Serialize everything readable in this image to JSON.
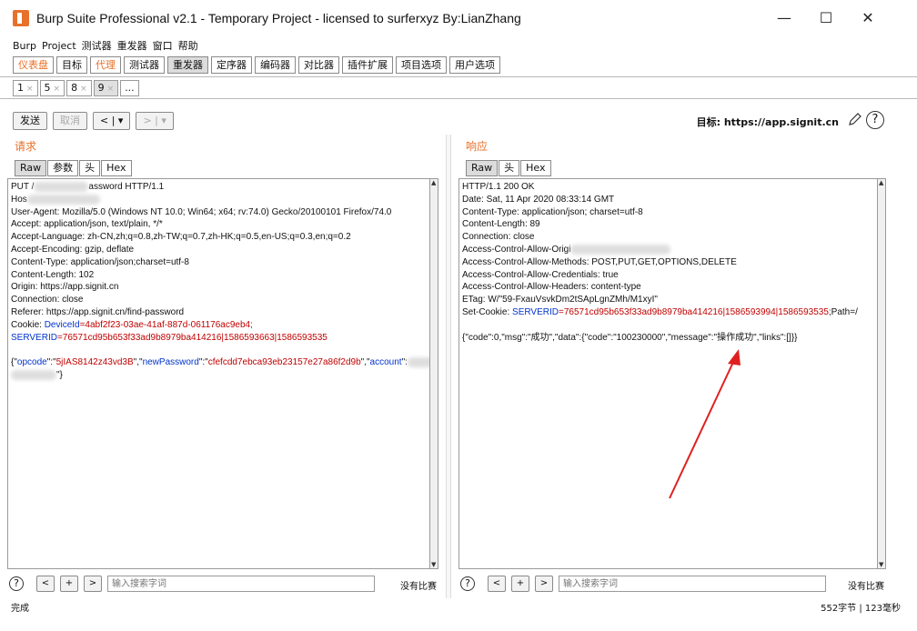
{
  "window": {
    "title": "Burp Suite Professional v2.1 - Temporary Project - licensed to surferxyz By:LianZhang",
    "minimize": "—",
    "maximize": "☐",
    "close": "✕"
  },
  "menu": [
    "Burp",
    "Project",
    "测试器",
    "重发器",
    "窗口",
    "帮助"
  ],
  "tabs": [
    "仪表盘",
    "目标",
    "代理",
    "测试器",
    "重发器",
    "定序器",
    "编码器",
    "对比器",
    "插件扩展",
    "项目选项",
    "用户选项"
  ],
  "subtabs": [
    {
      "label": "1",
      "close": "×"
    },
    {
      "label": "5",
      "close": "×"
    },
    {
      "label": "8",
      "close": "×"
    },
    {
      "label": "9",
      "close": "×"
    },
    {
      "label": "...",
      "close": ""
    }
  ],
  "toolbar": {
    "send": "发送",
    "cancel": "取消",
    "back": "< | ▾",
    "forward": "> | ▾",
    "target_label": "目标: https://app.signit.cn",
    "help": "?"
  },
  "request": {
    "title": "请求",
    "tabs": [
      "Raw",
      "参数",
      "头",
      "Hex"
    ],
    "lines": [
      "PUT /",
      "Hos",
      "User-Agent: Mozilla/5.0 (Windows NT 10.0; Win64; x64; rv:74.0) Gecko/20100101 Firefox/74.0",
      "Accept: application/json, text/plain, */*",
      "Accept-Language: zh-CN,zh;q=0.8,zh-TW;q=0.7,zh-HK;q=0.5,en-US;q=0.3,en;q=0.2",
      "Accept-Encoding: gzip, deflate",
      "Content-Type: application/json;charset=utf-8",
      "Content-Length: 102",
      "Origin: https://app.signit.cn",
      "Connection: close",
      "Referer: https://app.signit.cn/find-password"
    ],
    "line1_tail": "assword HTTP/1.1",
    "cookie_prefix": "Cookie: ",
    "cookie_key": "DeviceId",
    "cookie_val": "=4abf2f23-03ae-41af-887d-061176ac9eb4;",
    "server_key": "SERVERID",
    "server_val": "=76571cd95b653f33ad9b8979ba414216|1586593663|1586593535",
    "body_open": "{\"",
    "body_k1": "opcode",
    "body_s1": "\":\"",
    "body_v1": "5jIAS8142z43vd3B",
    "body_s2": "\",\"",
    "body_k2": "newPassword",
    "body_s3": "\":\"",
    "body_v2": "cfefcdd7ebca93eb23157e27a86f2d9b",
    "body_s4": "\",\"",
    "body_k3": "account",
    "body_s5": "\":",
    "body_close": "\"}"
  },
  "response": {
    "title": "响应",
    "tabs": [
      "Raw",
      "头",
      "Hex"
    ],
    "lines": [
      "HTTP/1.1 200 OK",
      "Date: Sat, 11 Apr 2020 08:33:14 GMT",
      "Content-Type: application/json; charset=utf-8",
      "Content-Length: 89",
      "Connection: close",
      "Access-Control-Allow-Origi",
      "Access-Control-Allow-Methods: POST,PUT,GET,OPTIONS,DELETE",
      "Access-Control-Allow-Credentials: true",
      "Access-Control-Allow-Headers: content-type",
      "ETag: W/\"59-FxauVsvkDm2tSApLgnZMh/M1xyI\""
    ],
    "setcookie_prefix": "Set-Cookie: ",
    "server_key": "SERVERID",
    "server_val": "=76571cd95b653f33ad9b8979ba414216|1586593994|1586593535",
    "setcookie_tail": ";Path=/",
    "body": "{\"code\":0,\"msg\":\"成功\",\"data\":{\"code\":\"100230000\",\"message\":\"操作成功\",\"links\":[]}}"
  },
  "search": {
    "placeholder": "输入搜索字词",
    "no_match": "没有比赛",
    "prev": "<",
    "add": "+",
    "next": ">",
    "help": "?"
  },
  "status": {
    "left": "完成",
    "right": "552字节 | 123毫秒"
  },
  "colors": {
    "accent": "#e8702a",
    "annotation_arrow": "#e02020",
    "key_blue": "#0033cc",
    "value_red": "#c00000"
  }
}
